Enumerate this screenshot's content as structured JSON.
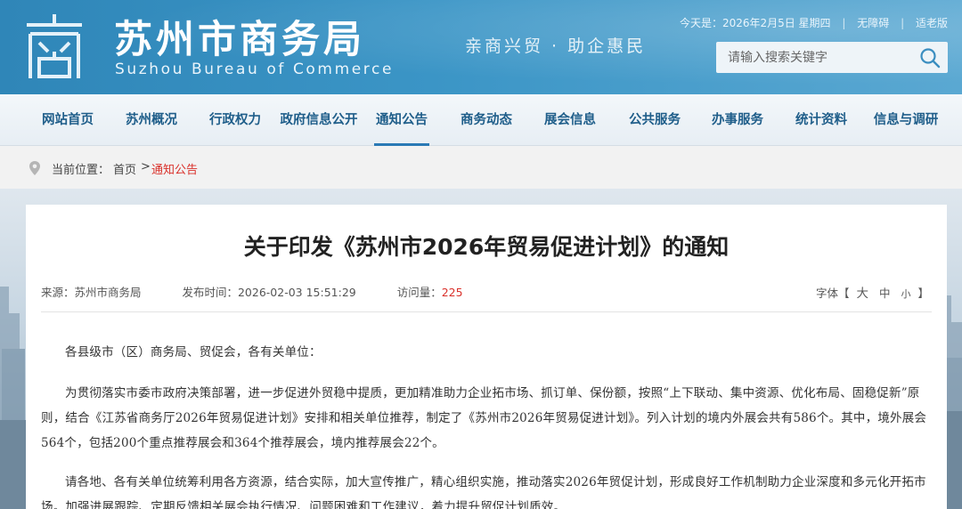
{
  "header": {
    "title": "苏州市商务局",
    "subtitle": "Suzhou Bureau of Commerce",
    "slogan": "亲商兴贸 · 助企惠民",
    "date_text": "今天是：2026年2月5日 星期四",
    "accessibility_link": "无障碍",
    "elderly_link": "适老版",
    "search_placeholder": "请输入搜索关键字"
  },
  "nav": {
    "items": [
      {
        "label": "网站首页"
      },
      {
        "label": "苏州概况"
      },
      {
        "label": "行政权力"
      },
      {
        "label": "政府信息公开"
      },
      {
        "label": "通知公告"
      },
      {
        "label": "商务动态"
      },
      {
        "label": "展会信息"
      },
      {
        "label": "公共服务"
      },
      {
        "label": "办事服务"
      },
      {
        "label": "统计资料"
      },
      {
        "label": "信息与调研"
      }
    ],
    "active_index": 4
  },
  "breadcrumb": {
    "label": "当前位置：",
    "home": "首页",
    "separator": ">",
    "current": "通知公告"
  },
  "article": {
    "title": "关于印发《苏州市2026年贸易促进计划》的通知",
    "source_label": "来源：苏州市商务局",
    "time_label": "发布时间：2026-02-03 15:51:29",
    "views_label": "访问量：",
    "views": "225",
    "font_label": "字体【",
    "font_large": "大",
    "font_medium": "中",
    "font_small": "小",
    "font_end": "】",
    "paragraphs": [
      "各县级市（区）商务局、贸促会，各有关单位：",
      "为贯彻落实市委市政府决策部署，进一步促进外贸稳中提质，更加精准助力企业拓市场、抓订单、保份额，按照“上下联动、集中资源、优化布局、固稳促新”原则，结合《江苏省商务厅2026年贸易促进计划》安排和相关单位推荐，制定了《苏州市2026年贸易促进计划》。列入计划的境内外展会共有586个。其中，境外展会564个，包括200个重点推荐展会和364个推荐展会，境内推荐展会22个。",
      "请各地、各有关单位统筹利用各方资源，结合实际，加大宣传推广，精心组织实施，推动落实2026年贸促计划，形成良好工作机制助力企业深度和多元化开拓市场。加强进展跟踪、定期反馈相关展会执行情况、问题困难和工作建议，着力提升贸促计划质效。"
    ]
  },
  "colors": {
    "header_blue": "#3b95c6",
    "nav_text": "#1f5e8a",
    "accent_red": "#d9302a"
  }
}
